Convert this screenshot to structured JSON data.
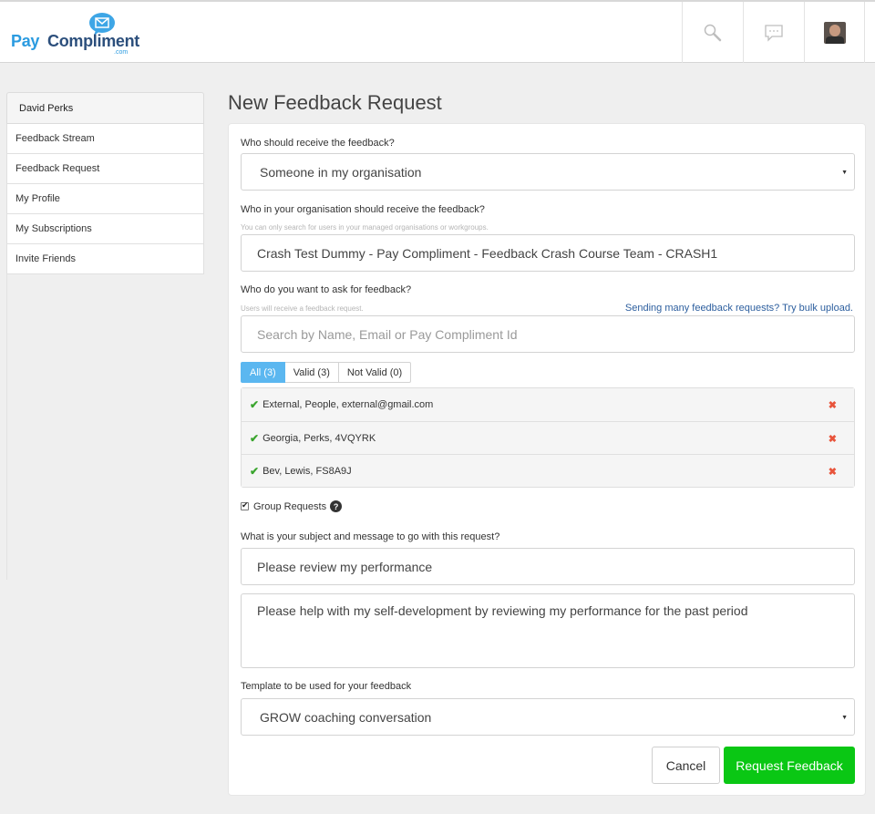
{
  "brand": {
    "pay": "Pay",
    "compliment": "Compliment",
    "com": ".com",
    "blue": "#2b9be0",
    "navy": "#2c4f7c"
  },
  "header": {
    "icons": [
      "search-icon",
      "chat-icon",
      "avatar"
    ]
  },
  "sidebar": {
    "user": "David Perks",
    "items": [
      {
        "label": "Feedback Stream"
      },
      {
        "label": "Feedback Request"
      },
      {
        "label": "My Profile"
      },
      {
        "label": "My Subscriptions"
      },
      {
        "label": "Invite Friends"
      }
    ]
  },
  "page": {
    "title": "New Feedback Request"
  },
  "form": {
    "receiver_label": "Who should receive the feedback?",
    "receiver_value": "Someone in my organisation",
    "org_label": "Who in your organisation should receive the feedback?",
    "org_hint": "You can only search for users in your managed organisations or workgroups.",
    "org_value": "Crash Test Dummy - Pay Compliment - Feedback Crash Course Team - CRASH1",
    "ask_label": "Who do you want to ask for feedback?",
    "ask_hint": "Users will receive a feedback request.",
    "bulk_link": "Sending many feedback requests? Try bulk upload.",
    "search_placeholder": "Search by Name, Email or Pay Compliment Id",
    "tabs": [
      {
        "label": "All (3)",
        "active": true
      },
      {
        "label": "Valid (3)",
        "active": false
      },
      {
        "label": "Not Valid (0)",
        "active": false
      }
    ],
    "recipients": [
      {
        "text": "External, People, external@gmail.com"
      },
      {
        "text": "Georgia, Perks, 4VQYRK"
      },
      {
        "text": "Bev, Lewis, FS8A9J"
      }
    ],
    "group_requests_label": "Group Requests",
    "group_requests_checked": true,
    "message_label": "What is your subject and message to go with this request?",
    "subject_value": "Please review my performance",
    "message_value": "Please help with my self-development by reviewing my performance for the past period",
    "template_label": "Template to be used for your feedback",
    "template_value": "GROW coaching conversation",
    "cancel_label": "Cancel",
    "submit_label": "Request Feedback",
    "submit_color": "#0ac714"
  }
}
